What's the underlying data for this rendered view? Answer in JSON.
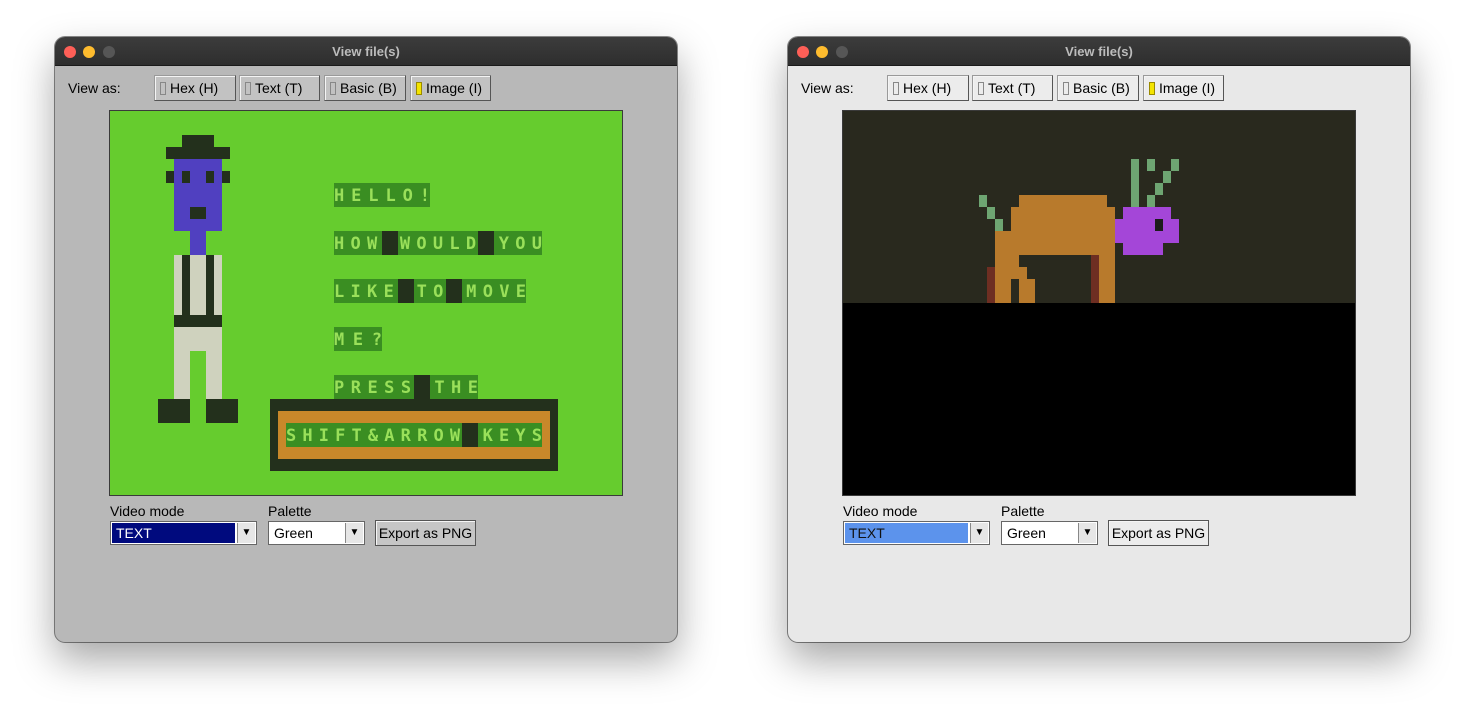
{
  "windows": [
    {
      "title": "View file(s)",
      "view_as_label": "View as:",
      "tabs": [
        {
          "label": "Hex (H)",
          "active": false
        },
        {
          "label": "Text (T)",
          "active": false
        },
        {
          "label": "Basic (B)",
          "active": false
        },
        {
          "label": "Image (I)",
          "active": true
        }
      ],
      "video_mode_label": "Video mode",
      "video_mode_value": "TEXT",
      "palette_label": "Palette",
      "palette_value": "Green",
      "export_label": "Export as PNG",
      "screen_text": [
        "HELLO!",
        "HOW WOULD YOU",
        "LIKE TO MOVE",
        "ME?",
        "PRESS THE",
        "SHIFT&ARROW KEYS"
      ]
    },
    {
      "title": "View file(s)",
      "view_as_label": "View as:",
      "tabs": [
        {
          "label": "Hex (H)",
          "active": false
        },
        {
          "label": "Text (T)",
          "active": false
        },
        {
          "label": "Basic (B)",
          "active": false
        },
        {
          "label": "Image (I)",
          "active": true
        }
      ],
      "video_mode_label": "Video mode",
      "video_mode_value": "TEXT",
      "palette_label": "Palette",
      "palette_value": "Green",
      "export_label": "Export as PNG"
    }
  ],
  "colors": {
    "screen_green": "#66cc2e",
    "text_block": "#3a8e22",
    "text_fg": "#9ae05a",
    "dark": "#23301c",
    "man_purple": "#5040c0",
    "pants": "#cfd2be",
    "box_orange": "#c8882a",
    "bg_dark": "#29291e",
    "animal_brown": "#b87a2c",
    "animal_dark": "#6e2e22",
    "antler": "#6ea572",
    "animal_head": "#a446d8"
  }
}
